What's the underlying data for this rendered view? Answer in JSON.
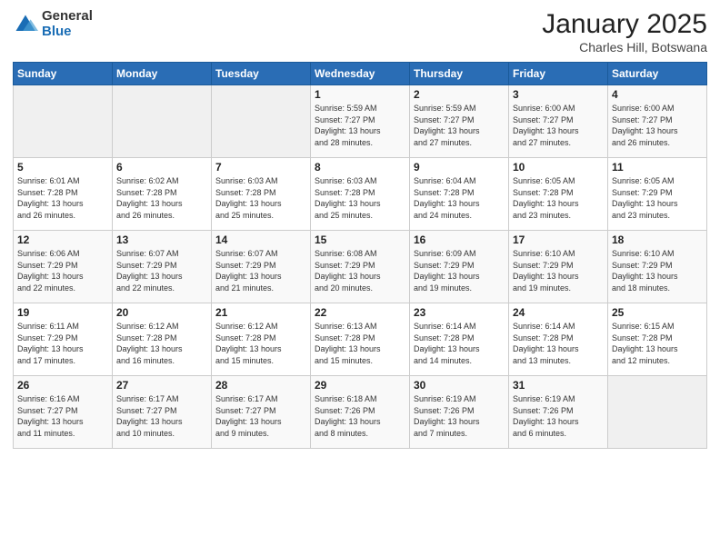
{
  "logo": {
    "general": "General",
    "blue": "Blue"
  },
  "title": "January 2025",
  "subtitle": "Charles Hill, Botswana",
  "days_of_week": [
    "Sunday",
    "Monday",
    "Tuesday",
    "Wednesday",
    "Thursday",
    "Friday",
    "Saturday"
  ],
  "weeks": [
    [
      {
        "day": "",
        "info": ""
      },
      {
        "day": "",
        "info": ""
      },
      {
        "day": "",
        "info": ""
      },
      {
        "day": "1",
        "info": "Sunrise: 5:59 AM\nSunset: 7:27 PM\nDaylight: 13 hours\nand 28 minutes."
      },
      {
        "day": "2",
        "info": "Sunrise: 5:59 AM\nSunset: 7:27 PM\nDaylight: 13 hours\nand 27 minutes."
      },
      {
        "day": "3",
        "info": "Sunrise: 6:00 AM\nSunset: 7:27 PM\nDaylight: 13 hours\nand 27 minutes."
      },
      {
        "day": "4",
        "info": "Sunrise: 6:00 AM\nSunset: 7:27 PM\nDaylight: 13 hours\nand 26 minutes."
      }
    ],
    [
      {
        "day": "5",
        "info": "Sunrise: 6:01 AM\nSunset: 7:28 PM\nDaylight: 13 hours\nand 26 minutes."
      },
      {
        "day": "6",
        "info": "Sunrise: 6:02 AM\nSunset: 7:28 PM\nDaylight: 13 hours\nand 26 minutes."
      },
      {
        "day": "7",
        "info": "Sunrise: 6:03 AM\nSunset: 7:28 PM\nDaylight: 13 hours\nand 25 minutes."
      },
      {
        "day": "8",
        "info": "Sunrise: 6:03 AM\nSunset: 7:28 PM\nDaylight: 13 hours\nand 25 minutes."
      },
      {
        "day": "9",
        "info": "Sunrise: 6:04 AM\nSunset: 7:28 PM\nDaylight: 13 hours\nand 24 minutes."
      },
      {
        "day": "10",
        "info": "Sunrise: 6:05 AM\nSunset: 7:28 PM\nDaylight: 13 hours\nand 23 minutes."
      },
      {
        "day": "11",
        "info": "Sunrise: 6:05 AM\nSunset: 7:29 PM\nDaylight: 13 hours\nand 23 minutes."
      }
    ],
    [
      {
        "day": "12",
        "info": "Sunrise: 6:06 AM\nSunset: 7:29 PM\nDaylight: 13 hours\nand 22 minutes."
      },
      {
        "day": "13",
        "info": "Sunrise: 6:07 AM\nSunset: 7:29 PM\nDaylight: 13 hours\nand 22 minutes."
      },
      {
        "day": "14",
        "info": "Sunrise: 6:07 AM\nSunset: 7:29 PM\nDaylight: 13 hours\nand 21 minutes."
      },
      {
        "day": "15",
        "info": "Sunrise: 6:08 AM\nSunset: 7:29 PM\nDaylight: 13 hours\nand 20 minutes."
      },
      {
        "day": "16",
        "info": "Sunrise: 6:09 AM\nSunset: 7:29 PM\nDaylight: 13 hours\nand 19 minutes."
      },
      {
        "day": "17",
        "info": "Sunrise: 6:10 AM\nSunset: 7:29 PM\nDaylight: 13 hours\nand 19 minutes."
      },
      {
        "day": "18",
        "info": "Sunrise: 6:10 AM\nSunset: 7:29 PM\nDaylight: 13 hours\nand 18 minutes."
      }
    ],
    [
      {
        "day": "19",
        "info": "Sunrise: 6:11 AM\nSunset: 7:29 PM\nDaylight: 13 hours\nand 17 minutes."
      },
      {
        "day": "20",
        "info": "Sunrise: 6:12 AM\nSunset: 7:28 PM\nDaylight: 13 hours\nand 16 minutes."
      },
      {
        "day": "21",
        "info": "Sunrise: 6:12 AM\nSunset: 7:28 PM\nDaylight: 13 hours\nand 15 minutes."
      },
      {
        "day": "22",
        "info": "Sunrise: 6:13 AM\nSunset: 7:28 PM\nDaylight: 13 hours\nand 15 minutes."
      },
      {
        "day": "23",
        "info": "Sunrise: 6:14 AM\nSunset: 7:28 PM\nDaylight: 13 hours\nand 14 minutes."
      },
      {
        "day": "24",
        "info": "Sunrise: 6:14 AM\nSunset: 7:28 PM\nDaylight: 13 hours\nand 13 minutes."
      },
      {
        "day": "25",
        "info": "Sunrise: 6:15 AM\nSunset: 7:28 PM\nDaylight: 13 hours\nand 12 minutes."
      }
    ],
    [
      {
        "day": "26",
        "info": "Sunrise: 6:16 AM\nSunset: 7:27 PM\nDaylight: 13 hours\nand 11 minutes."
      },
      {
        "day": "27",
        "info": "Sunrise: 6:17 AM\nSunset: 7:27 PM\nDaylight: 13 hours\nand 10 minutes."
      },
      {
        "day": "28",
        "info": "Sunrise: 6:17 AM\nSunset: 7:27 PM\nDaylight: 13 hours\nand 9 minutes."
      },
      {
        "day": "29",
        "info": "Sunrise: 6:18 AM\nSunset: 7:26 PM\nDaylight: 13 hours\nand 8 minutes."
      },
      {
        "day": "30",
        "info": "Sunrise: 6:19 AM\nSunset: 7:26 PM\nDaylight: 13 hours\nand 7 minutes."
      },
      {
        "day": "31",
        "info": "Sunrise: 6:19 AM\nSunset: 7:26 PM\nDaylight: 13 hours\nand 6 minutes."
      },
      {
        "day": "",
        "info": ""
      }
    ]
  ]
}
